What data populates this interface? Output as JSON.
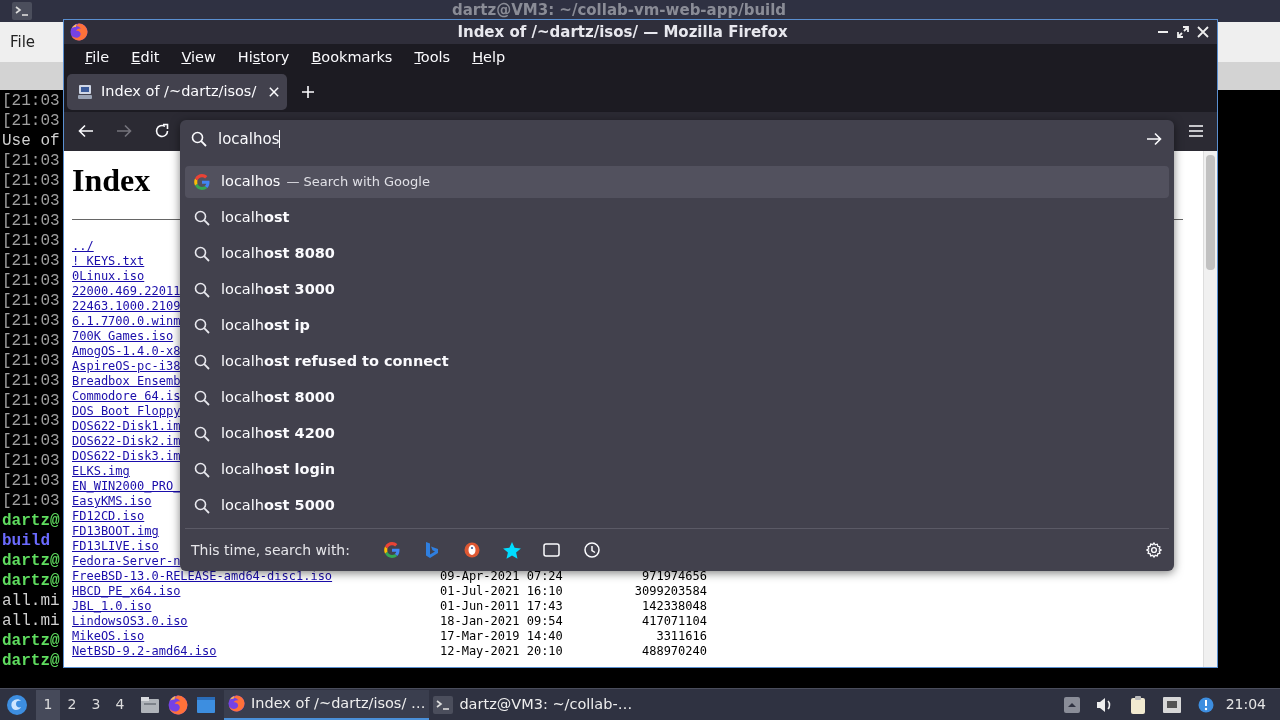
{
  "terminal": {
    "title": "dartz@VM3: ~/collab-vm-web-app/build",
    "menu": [
      "File"
    ],
    "lines": [
      {
        "kind": "log",
        "text": "[21:03"
      },
      {
        "kind": "log",
        "text": "[21:03"
      },
      {
        "kind": "output",
        "text": "Use of"
      },
      {
        "kind": "log",
        "text": "[21:03"
      },
      {
        "kind": "log",
        "text": "[21:03"
      },
      {
        "kind": "log",
        "text": "[21:03"
      },
      {
        "kind": "log",
        "text": "[21:03"
      },
      {
        "kind": "log",
        "text": "[21:03"
      },
      {
        "kind": "log",
        "text": "[21:03"
      },
      {
        "kind": "log",
        "text": "[21:03"
      },
      {
        "kind": "log",
        "text": "[21:03"
      },
      {
        "kind": "log",
        "text": "[21:03"
      },
      {
        "kind": "log",
        "text": "[21:03"
      },
      {
        "kind": "log",
        "text": "[21:03"
      },
      {
        "kind": "log",
        "text": "[21:03"
      },
      {
        "kind": "log",
        "text": "[21:03"
      },
      {
        "kind": "log",
        "text": "[21:03"
      },
      {
        "kind": "log",
        "text": "[21:03"
      },
      {
        "kind": "log",
        "text": "[21:03"
      },
      {
        "kind": "log",
        "text": "[21:03"
      },
      {
        "kind": "log",
        "text": "[21:03"
      },
      {
        "kind": "prompt",
        "text": "dartz@"
      },
      {
        "kind": "dir",
        "text": "build"
      },
      {
        "kind": "prompt",
        "text": "dartz@"
      },
      {
        "kind": "prompt",
        "text": "dartz@"
      },
      {
        "kind": "output",
        "text": "all.mi"
      },
      {
        "kind": "output",
        "text": "all.mi"
      },
      {
        "kind": "prompt",
        "text": "dartz@"
      },
      {
        "kind": "prompt",
        "text": "dartz@"
      }
    ]
  },
  "firefox": {
    "title": "Index of /~dartz/isos/ — Mozilla Firefox",
    "menu": [
      {
        "key": "F",
        "post": "ile"
      },
      {
        "key": "E",
        "post": "dit"
      },
      {
        "key": "V",
        "post": "iew"
      },
      {
        "pre": "Hi",
        "key": "s",
        "post": "tory"
      },
      {
        "key": "B",
        "post": "ookmarks"
      },
      {
        "key": "T",
        "post": "ools"
      },
      {
        "key": "H",
        "post": "elp"
      }
    ],
    "tabs": [
      {
        "title": "Index of /~dartz/isos/",
        "selected": true
      }
    ],
    "urlbar": {
      "value": "localhos"
    },
    "suggestions": [
      {
        "kind": "engine",
        "text": "localhos",
        "action": "— Search with Google",
        "selected": true
      },
      {
        "kind": "search",
        "text": "localh**ost**",
        "selected": false
      },
      {
        "kind": "search",
        "text": "localh**ost 8080**",
        "selected": false
      },
      {
        "kind": "search",
        "text": "localh**ost 3000**",
        "selected": false
      },
      {
        "kind": "search",
        "text": "localh**ost ip**",
        "selected": false
      },
      {
        "kind": "search",
        "text": "localh**ost refused to connect**",
        "selected": false
      },
      {
        "kind": "search",
        "text": "localh**ost 8000**",
        "selected": false
      },
      {
        "kind": "search",
        "text": "localh**ost 4200**",
        "selected": false
      },
      {
        "kind": "search",
        "text": "localh**ost login**",
        "selected": false
      },
      {
        "kind": "search",
        "text": "localh**ost 5000**",
        "selected": false
      }
    ],
    "search_with": {
      "label": "This time, search with:"
    },
    "page": {
      "heading": "Index",
      "files": [
        {
          "name": "../"
        },
        {
          "name": "! KEYS.txt"
        },
        {
          "name": "0Linux.iso"
        },
        {
          "name": "22000.469.22011"
        },
        {
          "name": "22463.1000.2109"
        },
        {
          "name": "6.1.7700.0.winm"
        },
        {
          "name": "700K Games.iso"
        },
        {
          "name": "AmogOS-1.4.0-x8"
        },
        {
          "name": "AspireOS-pc-i38"
        },
        {
          "name": "Breadbox Ensemb"
        },
        {
          "name": "Commodore 64.is"
        },
        {
          "name": "DOS Boot Floppy"
        },
        {
          "name": "DOS622-Disk1.im"
        },
        {
          "name": "DOS622-Disk2.im"
        },
        {
          "name": "DOS622-Disk3.im"
        },
        {
          "name": "ELKS.img"
        },
        {
          "name": "EN_WIN2000_PRO_"
        },
        {
          "name": "EasyKMS.iso"
        },
        {
          "name": "FD12CD.iso"
        },
        {
          "name": "FD13BOOT.img"
        },
        {
          "name": "FD13LIVE.iso"
        },
        {
          "name": "Fedora-Server-n"
        },
        {
          "name": "FreeBSD-13.0-RELEASE-amd64-disc1.iso",
          "date": "09-Apr-2021 07:24",
          "size": "971974656"
        },
        {
          "name": "HBCD_PE_x64.iso",
          "date": "01-Jul-2021 16:10",
          "size": "3099203584"
        },
        {
          "name": "JBL_1.0.iso",
          "date": "01-Jun-2011 17:43",
          "size": "142338048"
        },
        {
          "name": "LindowsOS3.0.iso",
          "date": "18-Jan-2021 09:54",
          "size": "417071104"
        },
        {
          "name": "MikeOS.iso",
          "date": "17-Mar-2019 14:40",
          "size": "3311616"
        },
        {
          "name": "NetBSD-9.2-amd64.iso",
          "date": "12-May-2021 20:10",
          "size": "488970240"
        }
      ]
    }
  },
  "taskbar": {
    "workspaces": [
      {
        "label": "1",
        "selected": true
      },
      {
        "label": "2",
        "selected": false
      },
      {
        "label": "3",
        "selected": false
      },
      {
        "label": "4",
        "selected": false
      }
    ],
    "tasks": [
      {
        "kind": "browser",
        "title": "Index of /~dartz/isos/ …",
        "selected": true
      },
      {
        "kind": "terminal",
        "title": "dartz@VM3: ~/collab-…",
        "selected": false
      }
    ],
    "clock": "21:04"
  }
}
